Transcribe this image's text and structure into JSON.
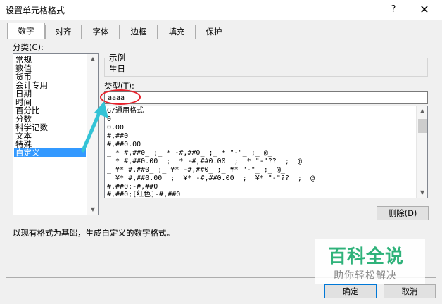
{
  "window": {
    "title": "设置单元格格式",
    "help": "?",
    "close": "✕"
  },
  "tabs": [
    {
      "label": "数字",
      "active": true
    },
    {
      "label": "对齐"
    },
    {
      "label": "字体"
    },
    {
      "label": "边框"
    },
    {
      "label": "填充"
    },
    {
      "label": "保护"
    }
  ],
  "category": {
    "label": "分类(C):",
    "items": [
      "常规",
      "数值",
      "货币",
      "会计专用",
      "日期",
      "时间",
      "百分比",
      "分数",
      "科学记数",
      "文本",
      "特殊",
      "自定义"
    ],
    "selected": "自定义"
  },
  "sample": {
    "label": "示例",
    "value": "生日"
  },
  "type": {
    "label": "类型(T):",
    "value": "aaaa",
    "formats": [
      "G/通用格式",
      "0",
      "0.00",
      "#,##0",
      "#,##0.00",
      "_ * #,##0_ ;_ * -#,##0_ ;_ * \"-\"_ ;_ @_",
      "_ * #,##0.00_ ;_ * -#,##0.00_ ;_ * \"-\"??_ ;_ @_",
      "_ ¥* #,##0_ ;_ ¥* -#,##0_ ;_ ¥* \"-\"_ ;_ @_",
      "_ ¥* #,##0.00_ ;_ ¥* -#,##0.00_ ;_ ¥* \"-\"??_ ;_ @_",
      "#,##0;-#,##0",
      "#,##0;[红色]-#,##0"
    ]
  },
  "buttons": {
    "delete": "删除(D)",
    "ok": "确定",
    "cancel": "取消"
  },
  "description": "以现有格式为基础，生成自定义的数字格式。",
  "watermark": {
    "title": "百科全说",
    "subtitle": "助你轻松解决"
  },
  "colors": {
    "selection": "#3399ff",
    "annotation_red": "#e8202a",
    "annotation_arrow": "#33c3d6",
    "watermark_green": "#2fb27a"
  }
}
